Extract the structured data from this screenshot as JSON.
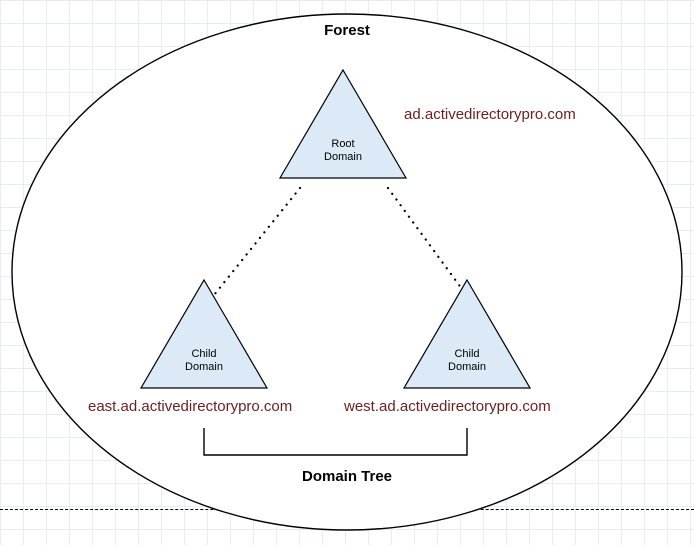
{
  "forest_label": "Forest",
  "tree_label": "Domain Tree",
  "root": {
    "line1": "Root",
    "line2": "Domain",
    "url": "ad.activedirectorypro.com"
  },
  "left_child": {
    "line1": "Child",
    "line2": "Domain",
    "url": "east.ad.activedirectorypro.com"
  },
  "right_child": {
    "line1": "Child",
    "line2": "Domain",
    "url": "west.ad.activedirectorypro.com"
  },
  "colors": {
    "triangle_fill": "#dbeaf6",
    "triangle_stroke": "#000",
    "ellipse_stroke": "#000",
    "url_text": "#6b1f1f"
  }
}
